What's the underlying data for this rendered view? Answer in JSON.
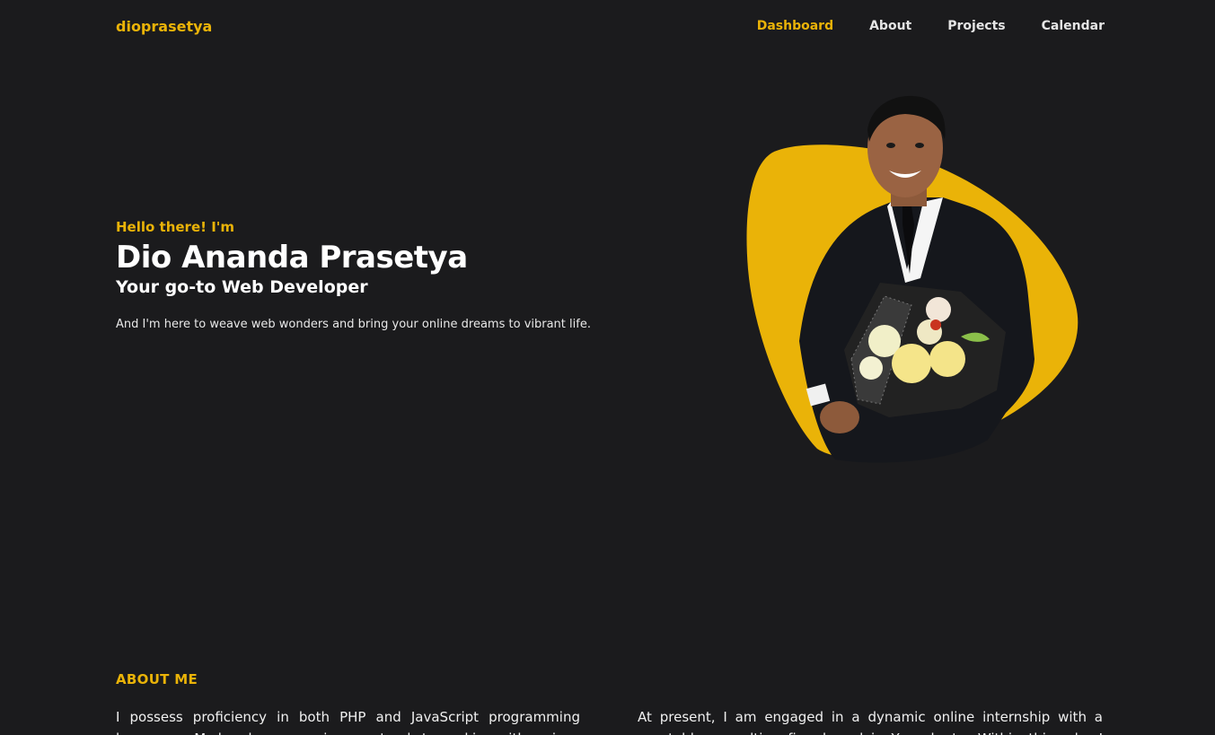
{
  "navbar": {
    "brand": "dioprasetya",
    "links": [
      {
        "label": "Dashboard",
        "active": true
      },
      {
        "label": "About",
        "active": false
      },
      {
        "label": "Projects",
        "active": false
      },
      {
        "label": "Calendar",
        "active": false
      }
    ]
  },
  "hero": {
    "greeting": "Hello there! I'm",
    "name": "Dio Ananda Prasetya",
    "role": "Your go-to Web Developer",
    "tagline": "And I'm here to weave web wonders and bring your online dreams to vibrant life."
  },
  "about": {
    "heading": "ABOUT ME",
    "paragraph_left": "I possess proficiency in both PHP and JavaScript programming languages. My hands-on experience extends to working with various",
    "paragraph_right": "At present, I am engaged in a dynamic online internship with a reputable consulting firm based in Yogyakarta. Within this role, I contribute"
  },
  "colors": {
    "accent": "#eab308",
    "background": "#1b1b1d",
    "text": "#ffffff"
  }
}
